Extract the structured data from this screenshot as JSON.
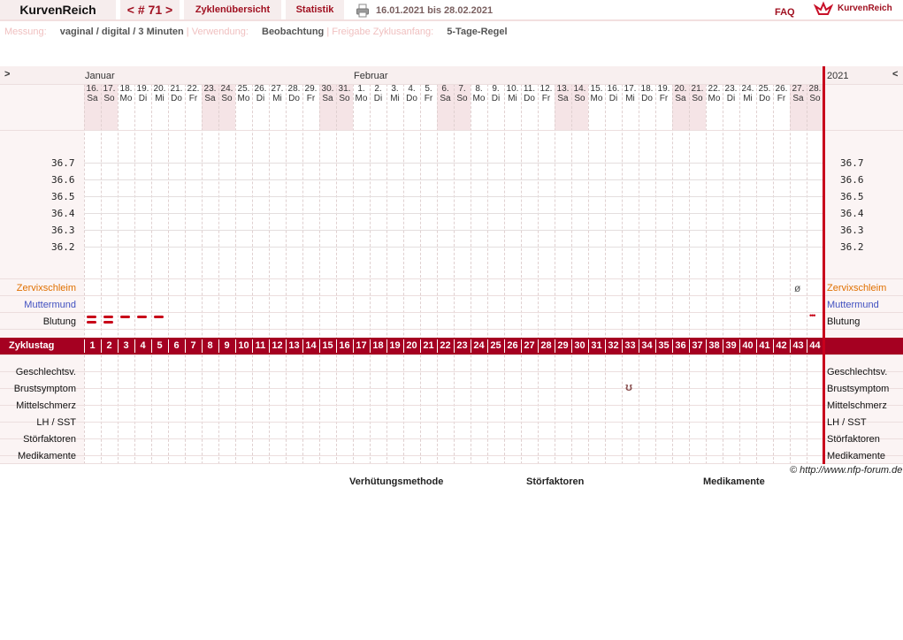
{
  "header": {
    "brand": "KurvenReich",
    "nav_cycle": "< # 71 >",
    "tab_overview": "Zyklenübersicht",
    "tab_stats": "Statistik",
    "date_range": "16.01.2021 bis 28.02.2021",
    "faq": "FAQ",
    "logo_text": "KurvenReich"
  },
  "info": {
    "measure_label": "Messung:",
    "measure_value": "vaginal / digital / 3 Minuten",
    "use_label": "Verwendung:",
    "use_value": "Beobachtung",
    "release_label": "Freigabe Zyklusanfang:",
    "release_value": "5-Tage-Regel",
    "sep": "|"
  },
  "chart": {
    "nav_left": ">",
    "nav_right": "<",
    "year": "2021",
    "month_jan": "Januar",
    "month_feb": "Februar",
    "days": [
      [
        "16.",
        "Sa"
      ],
      [
        "17.",
        "So"
      ],
      [
        "18.",
        "Mo"
      ],
      [
        "19.",
        "Di"
      ],
      [
        "20.",
        "Mi"
      ],
      [
        "21.",
        "Do"
      ],
      [
        "22.",
        "Fr"
      ],
      [
        "23.",
        "Sa"
      ],
      [
        "24.",
        "So"
      ],
      [
        "25.",
        "Mo"
      ],
      [
        "26.",
        "Di"
      ],
      [
        "27.",
        "Mi"
      ],
      [
        "28.",
        "Do"
      ],
      [
        "29.",
        "Fr"
      ],
      [
        "30.",
        "Sa"
      ],
      [
        "31.",
        "So"
      ],
      [
        "1.",
        "Mo"
      ],
      [
        "2.",
        "Di"
      ],
      [
        "3.",
        "Mi"
      ],
      [
        "4.",
        "Do"
      ],
      [
        "5.",
        "Fr"
      ],
      [
        "6.",
        "Sa"
      ],
      [
        "7.",
        "So"
      ],
      [
        "8.",
        "Mo"
      ],
      [
        "9.",
        "Di"
      ],
      [
        "10.",
        "Mi"
      ],
      [
        "11.",
        "Do"
      ],
      [
        "12.",
        "Fr"
      ],
      [
        "13.",
        "Sa"
      ],
      [
        "14.",
        "So"
      ],
      [
        "15.",
        "Mo"
      ],
      [
        "16.",
        "Di"
      ],
      [
        "17.",
        "Mi"
      ],
      [
        "18.",
        "Do"
      ],
      [
        "19.",
        "Fr"
      ],
      [
        "20.",
        "Sa"
      ],
      [
        "21.",
        "So"
      ],
      [
        "22.",
        "Mo"
      ],
      [
        "23.",
        "Di"
      ],
      [
        "24.",
        "Mi"
      ],
      [
        "25.",
        "Do"
      ],
      [
        "26.",
        "Fr"
      ],
      [
        "27.",
        "Sa"
      ],
      [
        "28.",
        "So"
      ]
    ],
    "temps": [
      "36.7",
      "36.6",
      "36.5",
      "36.4",
      "36.3",
      "36.2"
    ],
    "row_zervix": "Zervixschleim",
    "row_muttermund": "Muttermund",
    "row_blutung": "Blutung",
    "row_zyklustag": "Zyklustag",
    "zyklustage": [
      "1",
      "2",
      "3",
      "4",
      "5",
      "6",
      "7",
      "8",
      "9",
      "10",
      "11",
      "12",
      "13",
      "14",
      "15",
      "16",
      "17",
      "18",
      "19",
      "20",
      "21",
      "22",
      "23",
      "24",
      "25",
      "26",
      "27",
      "28",
      "29",
      "30",
      "31",
      "32",
      "33",
      "34",
      "35",
      "36",
      "37",
      "38",
      "39",
      "40",
      "41",
      "42",
      "43",
      "44"
    ],
    "rows_bottom": [
      "Geschlechtsv.",
      "Brustsymptom",
      "Mittelschmerz",
      "LH / SST",
      "Störfaktoren",
      "Medikamente"
    ],
    "zervix_symbol": "ø",
    "zervix_day": 43,
    "brust_symbol": "ʊ",
    "brust_day": 33,
    "blutung": [
      {
        "day": 1,
        "strength": "stark"
      },
      {
        "day": 2,
        "strength": "stark"
      },
      {
        "day": 3,
        "strength": "mittel"
      },
      {
        "day": 4,
        "strength": "mittel"
      },
      {
        "day": 5,
        "strength": "mittel"
      },
      {
        "day": 44,
        "strength": "schmierblutung"
      }
    ],
    "spot_symbol": "•••"
  },
  "footer": {
    "copyright": "© http://www.nfp-forum.de",
    "verhuetung": "Verhütungsmethode",
    "stoerfaktoren": "Störfaktoren",
    "medikamente": "Medikamente"
  }
}
